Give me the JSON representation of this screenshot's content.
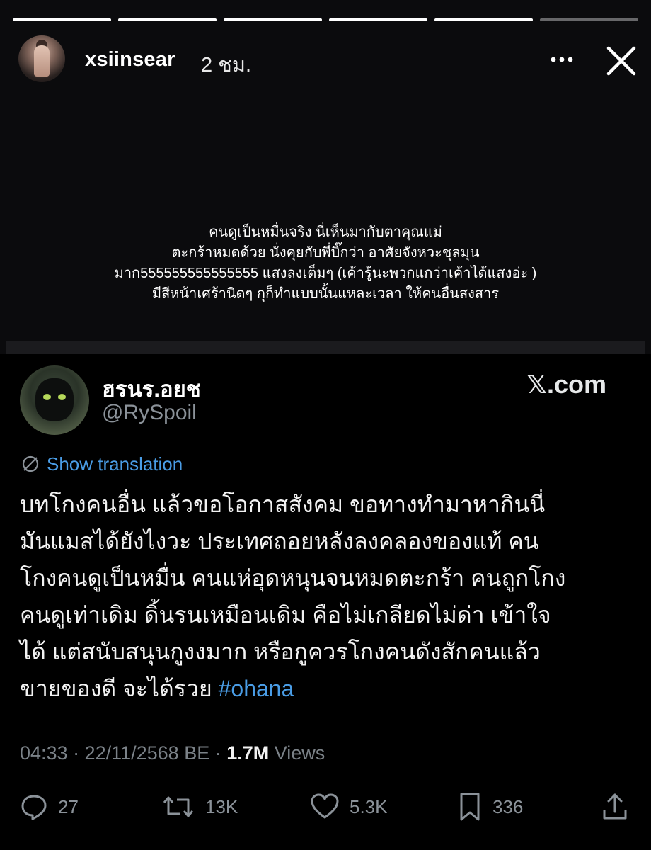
{
  "story": {
    "username": "xsiinsear",
    "time_ago": "2 ชม.",
    "progress": [
      1.0,
      1.0,
      1.0,
      1.0,
      1.0,
      0.0
    ],
    "caption_lines": [
      "คนดูเป็นหมื่นจริง นี่เห็นมากับตาคุณแม่",
      "ตะกร้าหมดด้วย นั่งคุยกับพี่บิ๊กว่า อาศัยจังหวะชุลมุน",
      "มาก555555555555555 แสงลงเต็มๆ (เค้ารู้นะพวกแกว่าเค้าได้แสงอ่ะ )",
      "มีสีหน้าเศร้านิดๆ กุก็ทำแบบนั้นแหละเวลา ให้คนอื่นสงสาร"
    ]
  },
  "tweet": {
    "display_name": "ฮรนร.อยช",
    "handle": "@RySpoil",
    "source": "𝕏.com",
    "show_translation": "Show translation",
    "body_lines": [
      "บทโกงคนอื่น แล้วขอโอกาสสังคม ขอทางทำมาหากินนี่",
      "มันแมสได้ยังไงวะ ประเทศถอยหลังลงคลองของแท้ คน",
      "โกงคนดูเป็นหมื่น คนแห่อุดหนุนจนหมดตะกร้า คนถูกโกง",
      "คนดูเท่าเดิม ดิ้นรนเหมือนเดิม คือไม่เกลียดไม่ด่า เข้าใจ",
      "ได้ แต่สนับสนุนกูงงมาก หรือกูควรโกงคนดังสักคนแล้ว"
    ],
    "last_line_text": "ขายของดี จะได้รวย ",
    "hashtag": "#ohana",
    "timestamp": "04:33 · 22/11/2568 BE · ",
    "views_count": "1.7M",
    "views_label": " Views",
    "actions": {
      "replies": "27",
      "reposts": "13K",
      "likes": "5.3K",
      "bookmarks": "336"
    }
  },
  "colors": {
    "link": "#4a9de6",
    "muted": "#8b9299",
    "background": "#000000"
  }
}
